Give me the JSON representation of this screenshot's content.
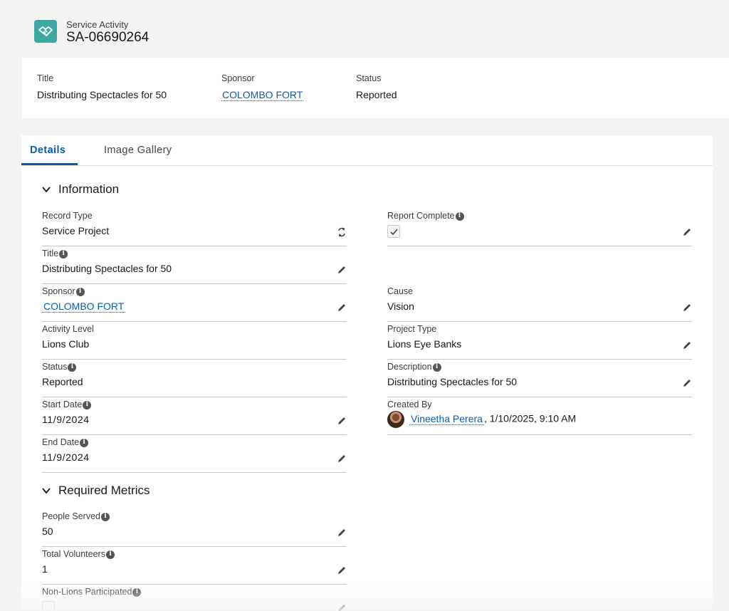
{
  "header": {
    "object_label": "Service Activity",
    "record_name": "SA-06690264",
    "icon": "handshake-icon",
    "icon_color": "#3ba99f"
  },
  "highlights": {
    "title_label": "Title",
    "title_value": "Distributing Spectacles for 50",
    "sponsor_label": "Sponsor",
    "sponsor_value": "COLOMBO FORT",
    "status_label": "Status",
    "status_value": "Reported"
  },
  "tabs": [
    {
      "label": "Details",
      "active": true
    },
    {
      "label": "Image Gallery",
      "active": false
    }
  ],
  "sections": {
    "information": "Information",
    "required_metrics": "Required Metrics"
  },
  "fields": {
    "record_type": {
      "label": "Record Type",
      "value": "Service Project"
    },
    "report_complete": {
      "label": "Report Complete",
      "checked": true
    },
    "title": {
      "label": "Title",
      "value": "Distributing Spectacles for 50"
    },
    "sponsor": {
      "label": "Sponsor",
      "value": "COLOMBO FORT"
    },
    "cause": {
      "label": "Cause",
      "value": "Vision"
    },
    "activity_level": {
      "label": "Activity Level",
      "value": "Lions Club"
    },
    "project_type": {
      "label": "Project Type",
      "value": "Lions Eye Banks"
    },
    "status": {
      "label": "Status",
      "value": "Reported"
    },
    "description": {
      "label": "Description",
      "value": "Distributing Spectacles for 50"
    },
    "start_date": {
      "label": "Start Date",
      "value": "11/9/2024"
    },
    "created_by": {
      "label": "Created By",
      "user": "Vineetha Perera",
      "timestamp": ", 1/10/2025, 9:10 AM"
    },
    "end_date": {
      "label": "End Date",
      "value": "11/9/2024"
    },
    "people_served": {
      "label": "People Served",
      "value": "50"
    },
    "total_volunteers": {
      "label": "Total Volunteers",
      "value": "1"
    },
    "non_lions_participated": {
      "label": "Non-Lions Participated",
      "checked": false
    }
  },
  "colors": {
    "accent": "#0b5cab",
    "background": "#f3f3f3"
  }
}
